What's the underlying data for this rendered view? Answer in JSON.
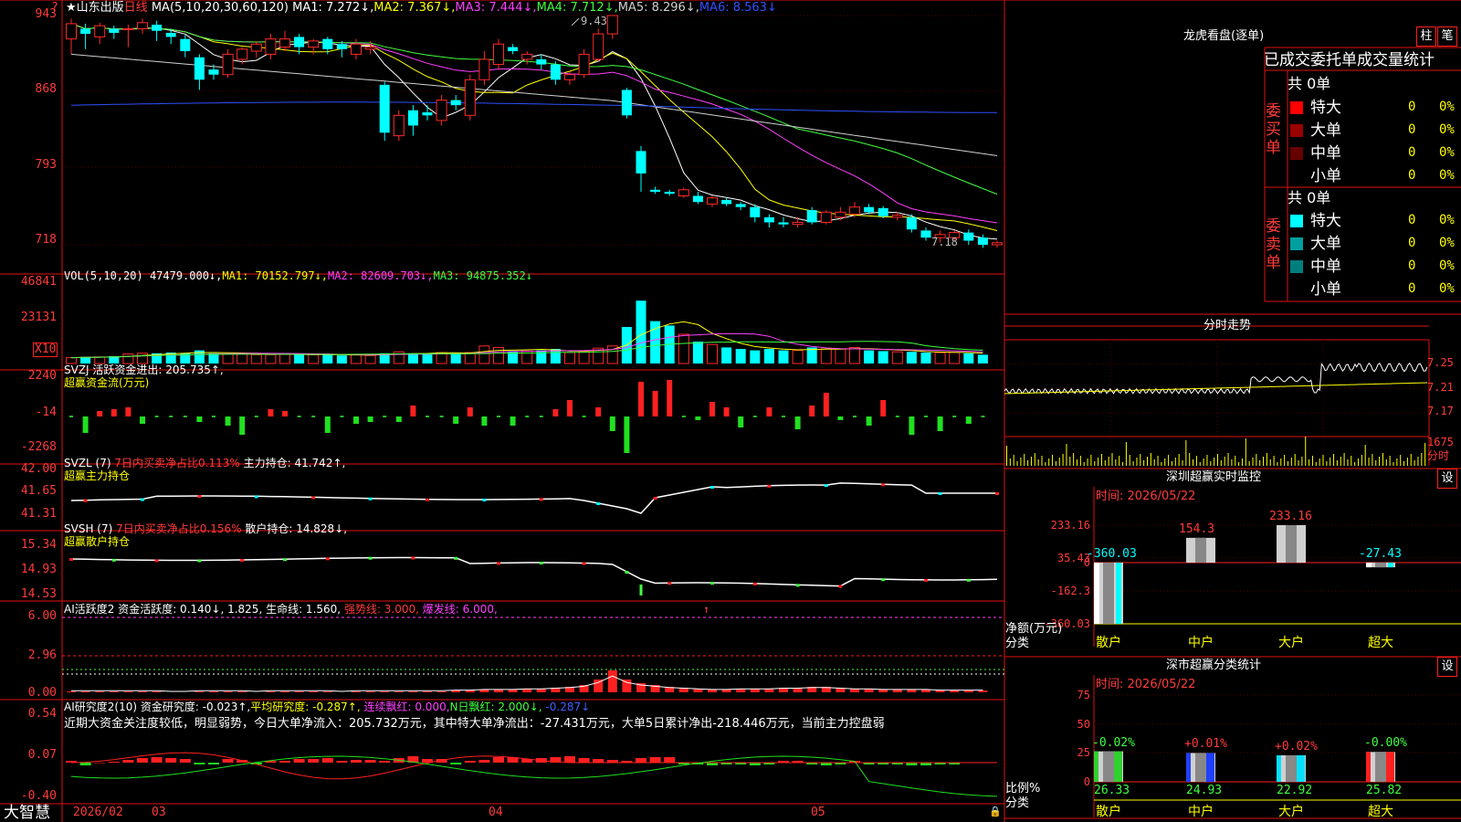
{
  "header": {
    "star": "★",
    "stock_name": "山东出版",
    "period": "日线",
    "ma_prefix": "MA(5,10,20,30,60,120)",
    "ma": [
      {
        "label": "MA1: 7.272↓,",
        "color": "#ffffff"
      },
      {
        "label": "MA2: 7.367↓,",
        "color": "#ffff00"
      },
      {
        "label": "MA3: 7.444↓,",
        "color": "#ff40ff"
      },
      {
        "label": "MA4: 7.712↓,",
        "color": "#40ff40"
      },
      {
        "label": "MA5: 8.296↓,",
        "color": "#d0d0d0"
      },
      {
        "label": "MA6: 8.563↓",
        "color": "#3050ff"
      }
    ],
    "qmark": "?"
  },
  "price_panel": {
    "yaxis": [
      "943",
      "868",
      "793",
      "718"
    ],
    "high_label": "9.43",
    "last_label": "7.18"
  },
  "vol_panel": {
    "title": "VOL(5,10,20)",
    "value": "47479.000↓,",
    "ma1": "MA1: 70152.797↓,",
    "ma2": "MA2: 82609.703↓,",
    "ma3": "MA3: 94875.352↓",
    "yaxis": [
      "46841",
      "23131"
    ],
    "unit": "X10"
  },
  "svzj_panel": {
    "title": "SVZJ  活跃资金进出: 205.735↑,",
    "subtitle": "超赢资金流(万元)",
    "yaxis": [
      "2240",
      "-14",
      "-2268"
    ]
  },
  "svzl_panel": {
    "title_a": "SVZL (7)",
    "title_b": "7日内买卖净占比0.113%",
    "title_c": "主力持仓: 41.742↑,",
    "subtitle": "超赢主力持仓",
    "yaxis": [
      "42.00",
      "41.65",
      "41.31"
    ]
  },
  "svsh_panel": {
    "title_a": "SVSH (7)",
    "title_b": "7日内买卖净占比0.156%",
    "title_c": "散户持仓: 14.828↓,",
    "subtitle": "超赢散户持仓",
    "yaxis": [
      "15.34",
      "14.93",
      "14.53"
    ]
  },
  "ai_active_panel": {
    "title_a": "AI活跃度2  资金活跃度: 0.140↓, 1.825, 生命线: 1.560,",
    "title_b": "强势线: 3.000,",
    "title_c": "爆发线: 6.000,",
    "arrow": "↑",
    "yaxis": [
      "6.00",
      "2.96",
      "0.00"
    ]
  },
  "ai_research_panel": {
    "title_a": "AI研究度2(10)  资金研究度: -0.023↑,",
    "title_b": "平均研究度: -0.287↑,",
    "title_c": "连续飘红: 0.000,",
    "title_d": "N日飘红: 2.000↓,",
    "title_e": "-0.287↓",
    "comment": "近期大资金关注度较低，明显弱势，今日大单净流入：205.732万元，其中特大单净流出：-27.431万元，大单5日累计净出-218.446万元，当前主力控盘弱",
    "yaxis": [
      "0.54",
      "0.07",
      "-0.40"
    ]
  },
  "bottom_axis": {
    "brand": "大智慧",
    "labels": [
      "2026/02",
      "03",
      "04",
      "05"
    ]
  },
  "dragon_panel": {
    "title": "龙虎看盘(逐单)",
    "btn_a": "柱",
    "btn_b": "笔",
    "tabs": "已成交委托单成交量统计",
    "buy_total": "共 0单",
    "buy_side": "委买单",
    "sell_total": "共 0单",
    "sell_side": "委卖单",
    "buy_rows": [
      {
        "label": "特大",
        "count": "0",
        "pct": "0%",
        "color": "#ff0000"
      },
      {
        "label": "大单",
        "count": "0",
        "pct": "0%",
        "color": "#9a0000"
      },
      {
        "label": "中单",
        "count": "0",
        "pct": "0%",
        "color": "#660000"
      },
      {
        "label": "小单",
        "count": "0",
        "pct": "0%",
        "color": ""
      }
    ],
    "sell_rows": [
      {
        "label": "特大",
        "count": "0",
        "pct": "0%",
        "color": "#00ffff"
      },
      {
        "label": "大单",
        "count": "0",
        "pct": "0%",
        "color": "#00a0a0"
      },
      {
        "label": "中单",
        "count": "0",
        "pct": "0%",
        "color": "#007f7f"
      },
      {
        "label": "小单",
        "count": "0",
        "pct": "0%",
        "color": ""
      }
    ]
  },
  "intraday_panel": {
    "title": "分时走势",
    "yaxis": [
      "7.25",
      "7.21",
      "7.17"
    ],
    "vol_label": "1675",
    "vol_unit": "分时"
  },
  "monitor_panel": {
    "title": "深圳超赢实时监控",
    "btn": "设",
    "time": "时间: 2026/05/22",
    "yaxis": [
      "233.16",
      "35.43",
      "0",
      "-162.3",
      "-360.03"
    ],
    "bottom_labels": [
      "净额(万元)",
      "分类"
    ],
    "categories": [
      "散户",
      "中户",
      "大户",
      "超大"
    ],
    "values": [
      -360.03,
      154.3,
      233.16,
      -27.43
    ],
    "value_labels": [
      "-360.03",
      "154.3",
      "233.16",
      "-27.43"
    ]
  },
  "classify_panel": {
    "title": "深市超赢分类统计",
    "btn": "设",
    "time": "时间: 2026/05/22",
    "yaxis": [
      "75",
      "50",
      "25",
      "0"
    ],
    "bottom_labels": [
      "比例%",
      "分类"
    ],
    "categories": [
      "散户",
      "中户",
      "大户",
      "超大"
    ],
    "values": [
      26.33,
      24.93,
      22.92,
      25.82
    ],
    "changes": [
      "-0.02%",
      "+0.01%",
      "+0.02%",
      "-0.00%"
    ],
    "bar_colors": [
      "#30d030",
      "#2040ff",
      "#00e0ff",
      "#ff2020"
    ]
  },
  "chart_data": {
    "type": "candlestick",
    "title": "山东出版 日线",
    "x_labels": [
      "2026/02",
      "03",
      "04",
      "05"
    ],
    "ylim": [
      7.1,
      9.45
    ],
    "candles": [
      {
        "o": 9.2,
        "c": 9.35,
        "h": 9.4,
        "l": 9.05
      },
      {
        "o": 9.3,
        "c": 9.25,
        "h": 9.35,
        "l": 9.1
      },
      {
        "o": 9.22,
        "c": 9.33,
        "h": 9.36,
        "l": 9.15
      },
      {
        "o": 9.3,
        "c": 9.26,
        "h": 9.33,
        "l": 9.2
      },
      {
        "o": 9.3,
        "c": 9.3,
        "h": 9.34,
        "l": 9.12
      },
      {
        "o": 9.3,
        "c": 9.36,
        "h": 9.4,
        "l": 9.25
      },
      {
        "o": 9.34,
        "c": 9.28,
        "h": 9.38,
        "l": 9.18
      },
      {
        "o": 9.26,
        "c": 9.22,
        "h": 9.3,
        "l": 9.15
      },
      {
        "o": 9.2,
        "c": 9.08,
        "h": 9.24,
        "l": 9.02
      },
      {
        "o": 9.02,
        "c": 8.8,
        "h": 9.05,
        "l": 8.7
      },
      {
        "o": 8.9,
        "c": 8.85,
        "h": 8.95,
        "l": 8.8
      },
      {
        "o": 8.85,
        "c": 9.05,
        "h": 9.1,
        "l": 8.82
      },
      {
        "o": 9.0,
        "c": 9.1,
        "h": 9.12,
        "l": 8.95
      },
      {
        "o": 9.08,
        "c": 9.15,
        "h": 9.18,
        "l": 9.02
      },
      {
        "o": 9.05,
        "c": 9.2,
        "h": 9.25,
        "l": 9.0
      },
      {
        "o": 9.12,
        "c": 9.2,
        "h": 9.28,
        "l": 9.08
      },
      {
        "o": 9.22,
        "c": 9.12,
        "h": 9.25,
        "l": 9.05
      },
      {
        "o": 9.12,
        "c": 9.18,
        "h": 9.2,
        "l": 9.05
      },
      {
        "o": 9.2,
        "c": 9.1,
        "h": 9.22,
        "l": 9.05
      },
      {
        "o": 9.15,
        "c": 9.1,
        "h": 9.18,
        "l": 9.02
      },
      {
        "o": 9.05,
        "c": 9.15,
        "h": 9.2,
        "l": 9.0
      },
      {
        "o": 9.1,
        "c": 9.12,
        "h": 9.18,
        "l": 9.05
      },
      {
        "o": 8.75,
        "c": 8.28,
        "h": 8.78,
        "l": 8.2
      },
      {
        "o": 8.25,
        "c": 8.45,
        "h": 8.5,
        "l": 8.2
      },
      {
        "o": 8.5,
        "c": 8.35,
        "h": 8.55,
        "l": 8.25
      },
      {
        "o": 8.48,
        "c": 8.45,
        "h": 8.55,
        "l": 8.4
      },
      {
        "o": 8.4,
        "c": 8.6,
        "h": 8.65,
        "l": 8.35
      },
      {
        "o": 8.6,
        "c": 8.55,
        "h": 8.65,
        "l": 8.5
      },
      {
        "o": 8.45,
        "c": 8.8,
        "h": 8.85,
        "l": 8.4
      },
      {
        "o": 8.8,
        "c": 9.0,
        "h": 9.08,
        "l": 8.75
      },
      {
        "o": 8.95,
        "c": 9.15,
        "h": 9.2,
        "l": 8.9
      },
      {
        "o": 9.12,
        "c": 9.08,
        "h": 9.15,
        "l": 9.05
      },
      {
        "o": 9.0,
        "c": 9.05,
        "h": 9.08,
        "l": 8.95
      },
      {
        "o": 9.0,
        "c": 8.95,
        "h": 9.05,
        "l": 8.9
      },
      {
        "o": 8.95,
        "c": 8.8,
        "h": 8.98,
        "l": 8.75
      },
      {
        "o": 8.8,
        "c": 8.85,
        "h": 8.88,
        "l": 8.75
      },
      {
        "o": 8.85,
        "c": 9.05,
        "h": 9.1,
        "l": 8.82
      },
      {
        "o": 9.0,
        "c": 9.25,
        "h": 9.3,
        "l": 8.98
      },
      {
        "o": 9.25,
        "c": 9.43,
        "h": 9.43,
        "l": 9.2
      },
      {
        "o": 8.7,
        "c": 8.45,
        "h": 8.72,
        "l": 8.42
      },
      {
        "o": 8.1,
        "c": 7.88,
        "h": 8.15,
        "l": 7.7
      },
      {
        "o": 7.72,
        "c": 7.7,
        "h": 7.75,
        "l": 7.68
      },
      {
        "o": 7.7,
        "c": 7.68,
        "h": 7.72,
        "l": 7.66
      },
      {
        "o": 7.66,
        "c": 7.72,
        "h": 7.74,
        "l": 7.64
      },
      {
        "o": 7.66,
        "c": 7.6,
        "h": 7.7,
        "l": 7.58
      },
      {
        "o": 7.58,
        "c": 7.64,
        "h": 7.66,
        "l": 7.55
      },
      {
        "o": 7.62,
        "c": 7.58,
        "h": 7.64,
        "l": 7.56
      },
      {
        "o": 7.58,
        "c": 7.55,
        "h": 7.6,
        "l": 7.52
      },
      {
        "o": 7.55,
        "c": 7.45,
        "h": 7.58,
        "l": 7.4
      },
      {
        "o": 7.45,
        "c": 7.4,
        "h": 7.48,
        "l": 7.35
      },
      {
        "o": 7.4,
        "c": 7.38,
        "h": 7.45,
        "l": 7.35
      },
      {
        "o": 7.38,
        "c": 7.4,
        "h": 7.45,
        "l": 7.35
      },
      {
        "o": 7.52,
        "c": 7.4,
        "h": 7.55,
        "l": 7.38
      },
      {
        "o": 7.4,
        "c": 7.5,
        "h": 7.52,
        "l": 7.38
      },
      {
        "o": 7.45,
        "c": 7.5,
        "h": 7.55,
        "l": 7.42
      },
      {
        "o": 7.48,
        "c": 7.55,
        "h": 7.6,
        "l": 7.45
      },
      {
        "o": 7.55,
        "c": 7.5,
        "h": 7.58,
        "l": 7.48
      },
      {
        "o": 7.54,
        "c": 7.46,
        "h": 7.56,
        "l": 7.44
      },
      {
        "o": 7.45,
        "c": 7.47,
        "h": 7.5,
        "l": 7.42
      },
      {
        "o": 7.45,
        "c": 7.33,
        "h": 7.48,
        "l": 7.3
      },
      {
        "o": 7.32,
        "c": 7.25,
        "h": 7.35,
        "l": 7.22
      },
      {
        "o": 7.25,
        "c": 7.28,
        "h": 7.32,
        "l": 7.2
      },
      {
        "o": 7.25,
        "c": 7.3,
        "h": 7.32,
        "l": 7.22
      },
      {
        "o": 7.3,
        "c": 7.22,
        "h": 7.33,
        "l": 7.18
      },
      {
        "o": 7.25,
        "c": 7.18,
        "h": 7.28,
        "l": 7.15
      },
      {
        "o": 7.18,
        "c": 7.2,
        "h": 7.22,
        "l": 7.15
      }
    ]
  }
}
